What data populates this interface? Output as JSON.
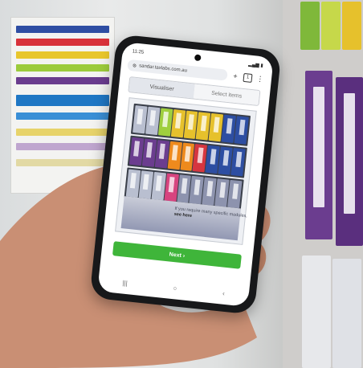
{
  "browser": {
    "time": "11:25",
    "url": "sandar.taxlabs.com.au",
    "new_tab_glyph": "+",
    "tab_count": "1",
    "menu_glyph": "⋮"
  },
  "tabs": [
    {
      "label": "Visualiser",
      "active": true
    },
    {
      "label": "Select items",
      "active": false
    }
  ],
  "visualiser": {
    "note_text": "If you require many specific modules,",
    "note_link": "see here"
  },
  "next_button": {
    "label": "Next ›"
  },
  "nav": {
    "back": "‹",
    "home": "○",
    "recent": "|||"
  },
  "colors": {
    "accent_green": "#3fb53a",
    "rack_dark": "#3a3f4a",
    "binder_purple": "#6b3d8f",
    "binder_yellow": "#e6c12c",
    "binder_blue": "#2d4ea2",
    "binder_orange": "#ee8a1d",
    "binder_red": "#d6363f",
    "binder_pink": "#d7447f",
    "binder_grey": "#b9bfd0"
  }
}
